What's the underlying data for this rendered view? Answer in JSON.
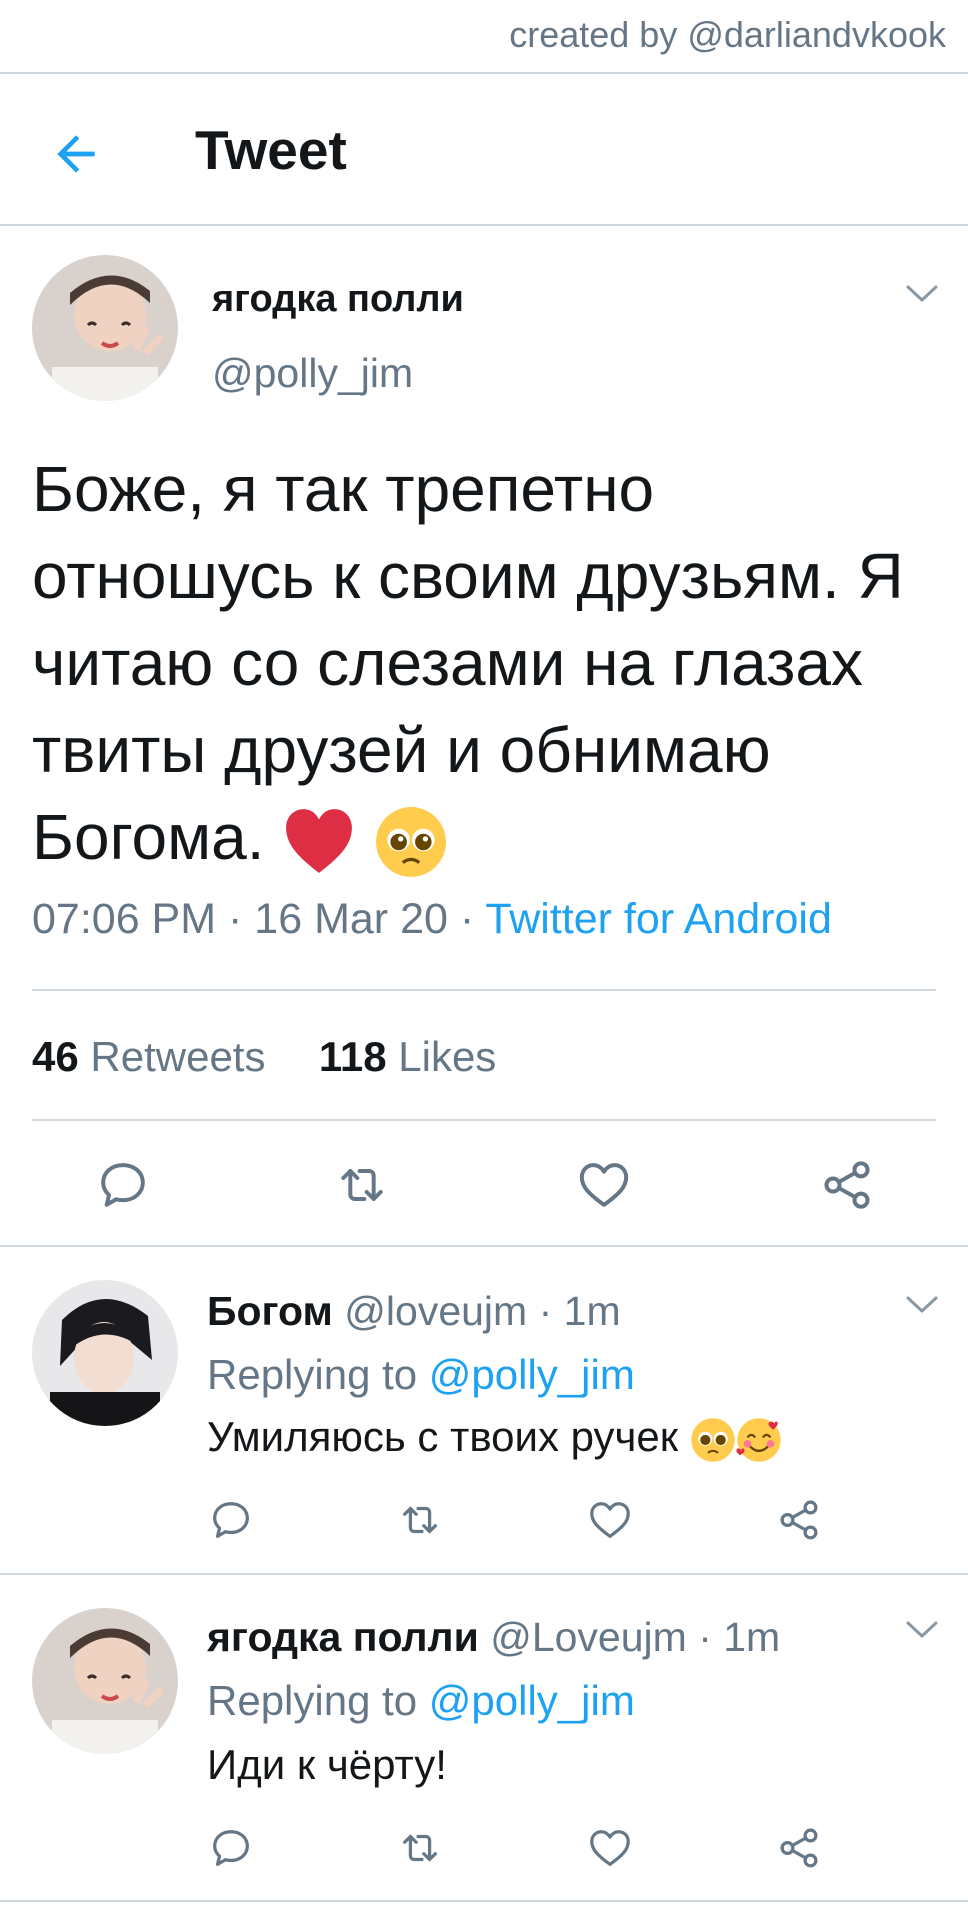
{
  "watermark": "created by @darliandvkook",
  "header": {
    "back_icon": "arrow-left-icon",
    "title": "Tweet"
  },
  "tweet": {
    "author_name": "ягодка полли",
    "author_handle": "@polly_jim",
    "text": "Боже, я так трепетно отношусь к своим друзьям. Я читаю со слезами на глазах твиты друзей и обнимаю Богома.",
    "emojis": [
      "red-heart",
      "pleading-face"
    ],
    "time": "07:06 PM",
    "date": "16 Mar 20",
    "source": "Twitter for Android",
    "retweets_count": "46",
    "retweets_label": "Retweets",
    "likes_count": "118",
    "likes_label": "Likes"
  },
  "replies": [
    {
      "name": "Богом",
      "handle": "@loveujm",
      "time": "1m",
      "replying_label": "Replying to",
      "replying_handle": "@polly_jim",
      "text": "Умиляюсь с твоих ручек",
      "emojis": [
        "pleading-face",
        "smiling-face-with-hearts"
      ]
    },
    {
      "name": "ягодка полли",
      "handle": "@Loveujm",
      "time": "1m",
      "replying_label": "Replying to",
      "replying_handle": "@polly_jim",
      "text": "Иди к чёрту!",
      "emojis": []
    }
  ],
  "colors": {
    "accent": "#1da1f2",
    "muted": "#657786",
    "text": "#14171a",
    "divider": "#cfd6dc"
  }
}
